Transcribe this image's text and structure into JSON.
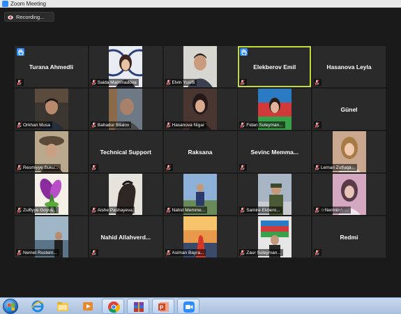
{
  "window": {
    "title": "Zoom Meeting"
  },
  "recording": {
    "label": "Recording..."
  },
  "participants": [
    {
      "name": "Turana Ahmedli",
      "type": "name",
      "hand": true
    },
    {
      "name": "Saida Mammadova",
      "type": "photo",
      "kind": "woman-logo"
    },
    {
      "name": "Elvin Yusifli",
      "type": "photo",
      "kind": "man-light"
    },
    {
      "name": "Elekberov Emil",
      "type": "name",
      "hand": true,
      "speaking": true
    },
    {
      "name": "Hasanova Leyla",
      "type": "name"
    },
    {
      "name": "Orkhan Musa",
      "type": "photo",
      "kind": "man-dark"
    },
    {
      "name": "Bahadur Bilalov",
      "type": "photo",
      "kind": "man-shelf"
    },
    {
      "name": "Hasanova Nigar",
      "type": "photo",
      "kind": "woman-dark"
    },
    {
      "name": "Fidan Suleyman...",
      "type": "photo",
      "kind": "woman-flag"
    },
    {
      "name": "Günel",
      "type": "name"
    },
    {
      "name": "Resmiyye Suku...",
      "type": "photo",
      "kind": "woman-hat"
    },
    {
      "name": "Technical Support",
      "type": "name"
    },
    {
      "name": "Raksana",
      "type": "name"
    },
    {
      "name": "Sevinc  Memma...",
      "type": "name"
    },
    {
      "name": "Leman Zulfuqa...",
      "type": "photo",
      "kind": "woman-blonde"
    },
    {
      "name": "Zulfiyye Goyus...",
      "type": "photo",
      "kind": "flower"
    },
    {
      "name": "Aishe Pashayeva",
      "type": "photo",
      "kind": "horse"
    },
    {
      "name": "Nahid Memme...",
      "type": "photo",
      "kind": "man-outdoor"
    },
    {
      "name": "Samire Ekbero...",
      "type": "photo",
      "kind": "soldier"
    },
    {
      "name": "☆Nermin☆ ...",
      "type": "photo",
      "kind": "woman-pink"
    },
    {
      "name": "Nemet Rustem...",
      "type": "photo",
      "kind": "man-lake"
    },
    {
      "name": "Nahid  Allahverd...",
      "type": "name"
    },
    {
      "name": "Asiman Bayra...",
      "type": "photo",
      "kind": "sunset"
    },
    {
      "name": "Zaur Suleyman...",
      "type": "photo",
      "kind": "man-flag"
    },
    {
      "name": "Redmi",
      "type": "name"
    }
  ],
  "taskbar": {
    "apps": [
      "start-icon",
      "ie-icon",
      "explorer-icon",
      "media-icon",
      "chrome-icon",
      "winrar-icon",
      "powerpoint-icon",
      "zoom-icon"
    ]
  }
}
